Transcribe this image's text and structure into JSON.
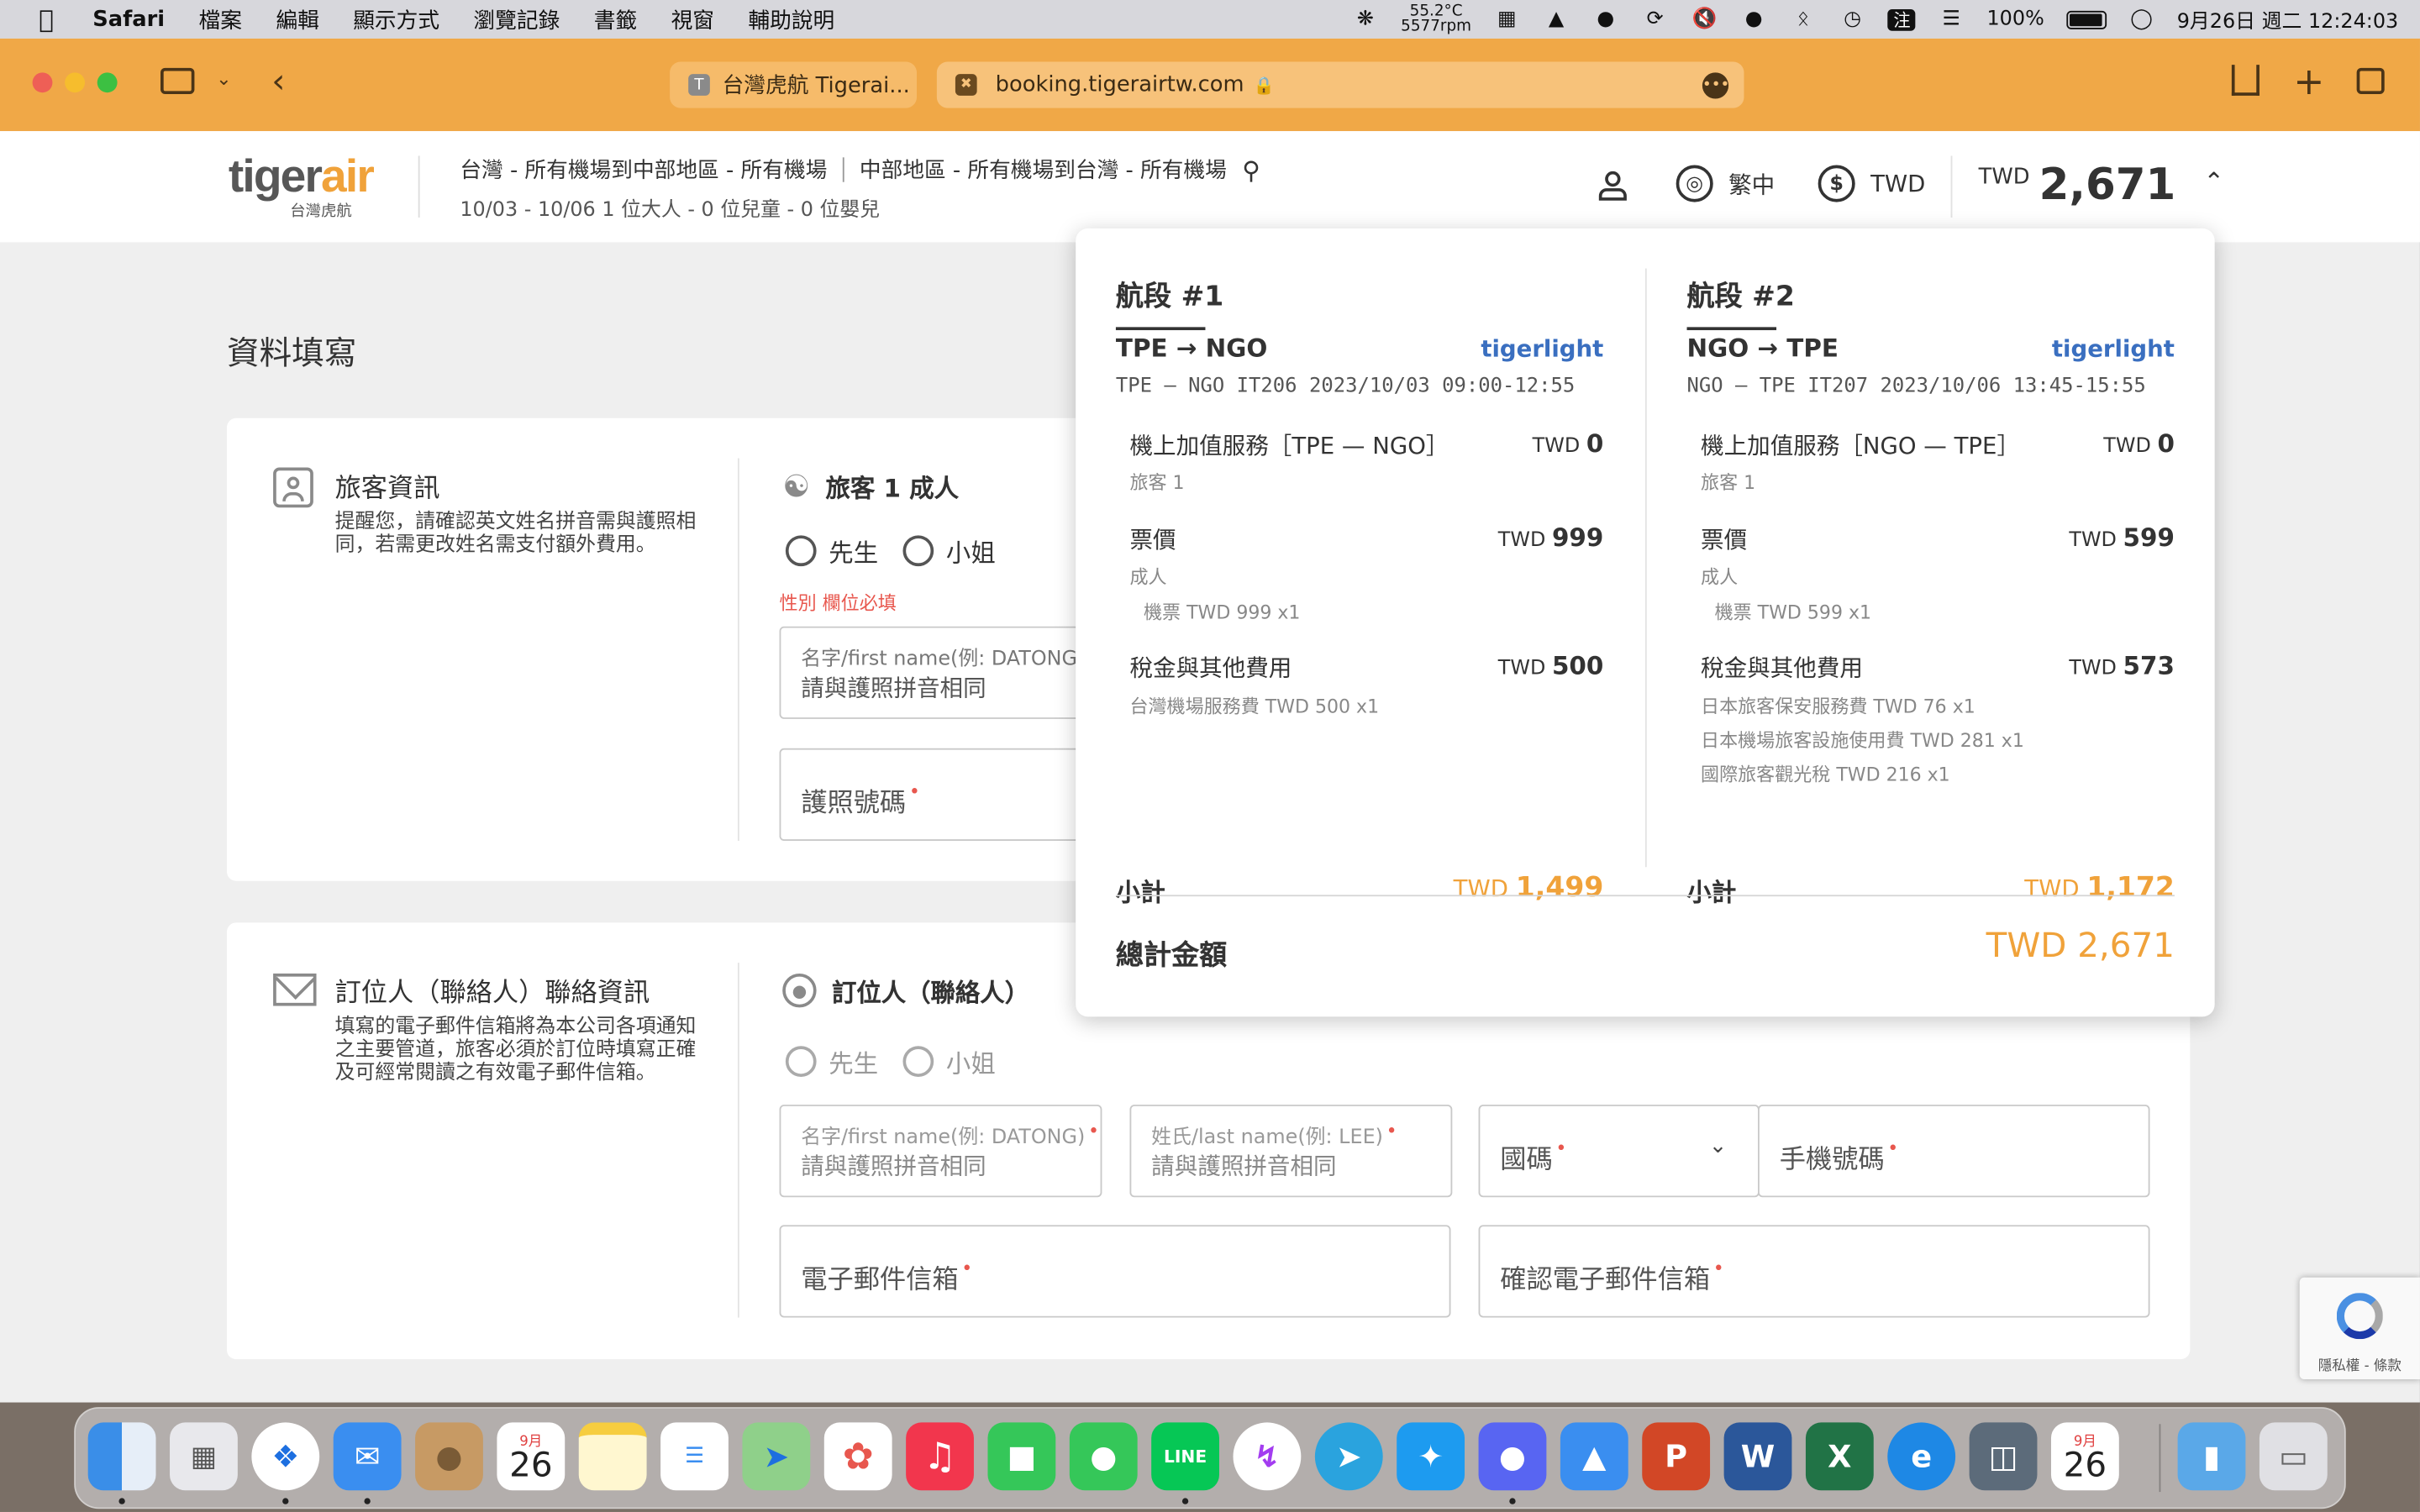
{
  "menubar": {
    "app": "Safari",
    "items": [
      "檔案",
      "編輯",
      "顯示方式",
      "瀏覽記錄",
      "書籤",
      "視窗",
      "輔助說明"
    ],
    "temp": "55.2°C",
    "rpm": "5577rpm",
    "input_method": "注",
    "battery": "100%",
    "datetime": "9月26日 週二 12:24:03"
  },
  "browser": {
    "tab_title": "台灣虎航 Tigerai...",
    "tab_favicon": "T",
    "url": "booking.tigerairtw.com"
  },
  "header": {
    "logo_word_a": "tiger",
    "logo_word_b": "air",
    "logo_sub": "台灣虎航",
    "route_out": "台灣 - 所有機場到中部地區 - 所有機場",
    "route_back": "中部地區 - 所有機場到台灣 - 所有機場",
    "trip_info": "10/03 - 10/06  1 位大人 - 0 位兒童 - 0 位嬰兒",
    "language": "繁中",
    "currency": "TWD",
    "total_currency": "TWD",
    "total_amount": "2,671"
  },
  "page": {
    "title": "資料填寫",
    "passenger_section": {
      "title": "旅客資訊",
      "desc": "提醒您，請確認英文姓名拼音需與護照相同，若需更改姓名需支付額外費用。",
      "pax_label": "旅客 1 成人",
      "mr": "先生",
      "ms": "小姐",
      "error": "性別 欄位必填",
      "firstname_label": "名字/first name(例: DATONG)",
      "firstname_placeholder": "請與護照拼音相同",
      "passport_label": "護照號碼"
    },
    "contact_section": {
      "title": "訂位人（聯絡人）聯絡資訊",
      "desc": "填寫的電子郵件信箱將為本公司各項通知之主要管道，旅客必須於訂位時填寫正確及可經常閱讀之有效電子郵件信箱。",
      "contact_label": "訂位人（聯絡人）",
      "mr": "先生",
      "ms": "小姐",
      "firstname_label": "名字/first name(例: DATONG)",
      "firstname_placeholder": "請與護照拼音相同",
      "lastname_label": "姓氏/last name(例: LEE)",
      "lastname_placeholder": "請與護照拼音相同",
      "country_code_label": "國碼",
      "phone_label": "手機號碼",
      "email_label": "電子郵件信箱",
      "email_confirm_label": "確認電子郵件信箱"
    }
  },
  "price_panel": {
    "segments": [
      {
        "heading": "航段 #1",
        "route": "TPE → NGO",
        "fare_type": "tigerlight",
        "flight": "TPE — NGO  IT206 2023/10/03 09:00-12:55",
        "addon_name": "機上加值服務［TPE — NGO］",
        "addon_cur": "TWD",
        "addon_amount": "0",
        "addon_sub": "旅客 1",
        "fare_name": "票價",
        "fare_cur": "TWD",
        "fare_amount": "999",
        "fare_sub": "成人",
        "fare_detail": "機票 TWD 999 x1",
        "tax_name": "稅金與其他費用",
        "tax_cur": "TWD",
        "tax_amount": "500",
        "tax_lines": [
          "台灣機場服務費 TWD 500 x1"
        ],
        "subtotal_label": "小計",
        "subtotal_cur": "TWD",
        "subtotal_amount": "1,499"
      },
      {
        "heading": "航段 #2",
        "route": "NGO → TPE",
        "fare_type": "tigerlight",
        "flight": "NGO — TPE  IT207 2023/10/06 13:45-15:55",
        "addon_name": "機上加值服務［NGO — TPE］",
        "addon_cur": "TWD",
        "addon_amount": "0",
        "addon_sub": "旅客 1",
        "fare_name": "票價",
        "fare_cur": "TWD",
        "fare_amount": "599",
        "fare_sub": "成人",
        "fare_detail": "機票 TWD 599 x1",
        "tax_name": "稅金與其他費用",
        "tax_cur": "TWD",
        "tax_amount": "573",
        "tax_lines": [
          "日本旅客保安服務費 TWD 76 x1",
          "日本機場旅客設施使用費 TWD 281 x1",
          "國際旅客觀光稅 TWD 216 x1"
        ],
        "subtotal_label": "小計",
        "subtotal_cur": "TWD",
        "subtotal_amount": "1,172"
      }
    ],
    "grand_label": "總計金額",
    "grand_amount": "TWD 2,671"
  },
  "recaptcha": {
    "text": "隱私權 - 條款"
  },
  "dock": {
    "calendar_month": "9月",
    "calendar_day": "26",
    "apps": [
      "finder",
      "launchpad",
      "safari",
      "mail",
      "contacts",
      "calendar",
      "notes",
      "reminders",
      "maps",
      "photos",
      "music",
      "facetime",
      "messages",
      "line",
      "messenger",
      "telegram",
      "twitter",
      "discord",
      "keynote",
      "powerpoint",
      "word",
      "excel",
      "edge",
      "screen-monitor",
      "calendar-2",
      "folder",
      "trash"
    ]
  },
  "colors": {
    "toolbar": "#f0a847",
    "accent_orange": "#f0a23a",
    "fare_blue": "#3a6fc0",
    "error_red": "#e8574e"
  }
}
